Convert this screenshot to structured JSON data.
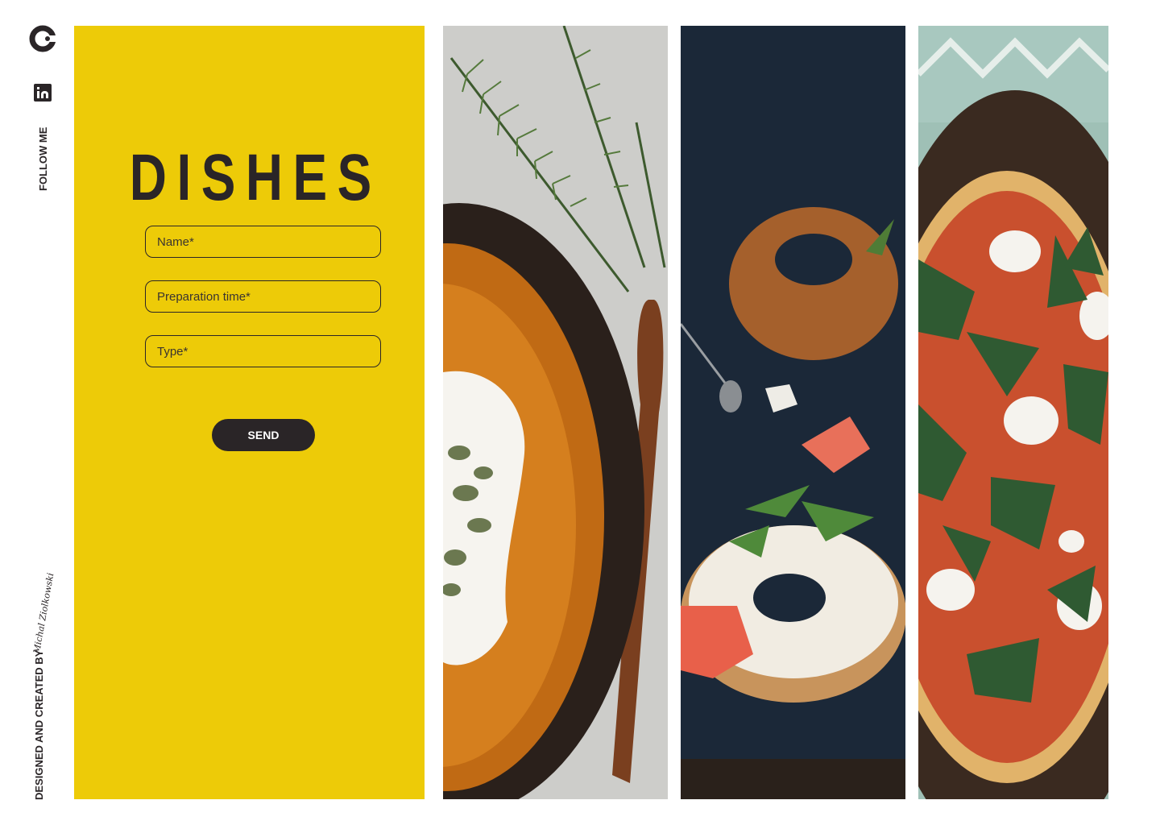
{
  "rail": {
    "follow_label": "FOLLOW ME",
    "designed_label": "DESIGNED AND CREATED BY",
    "signature": "Michal Ziolkowski"
  },
  "form": {
    "title": "DISHES",
    "fields": [
      {
        "placeholder": "Name*"
      },
      {
        "placeholder": "Preparation time*"
      },
      {
        "placeholder": "Type*"
      }
    ],
    "send_label": "SEND"
  },
  "photos": [
    {
      "subject": "pumpkin soup bowl with rosemary and wooden spoon"
    },
    {
      "subject": "bagels with salmon, cream cheese and arugula"
    },
    {
      "subject": "pizza with arugula and mozzarella"
    }
  ],
  "colors": {
    "accent": "#edcb08",
    "dark": "#2a2527",
    "background": "#ffffff"
  },
  "icons": [
    "logo-icon",
    "linkedin-icon"
  ]
}
